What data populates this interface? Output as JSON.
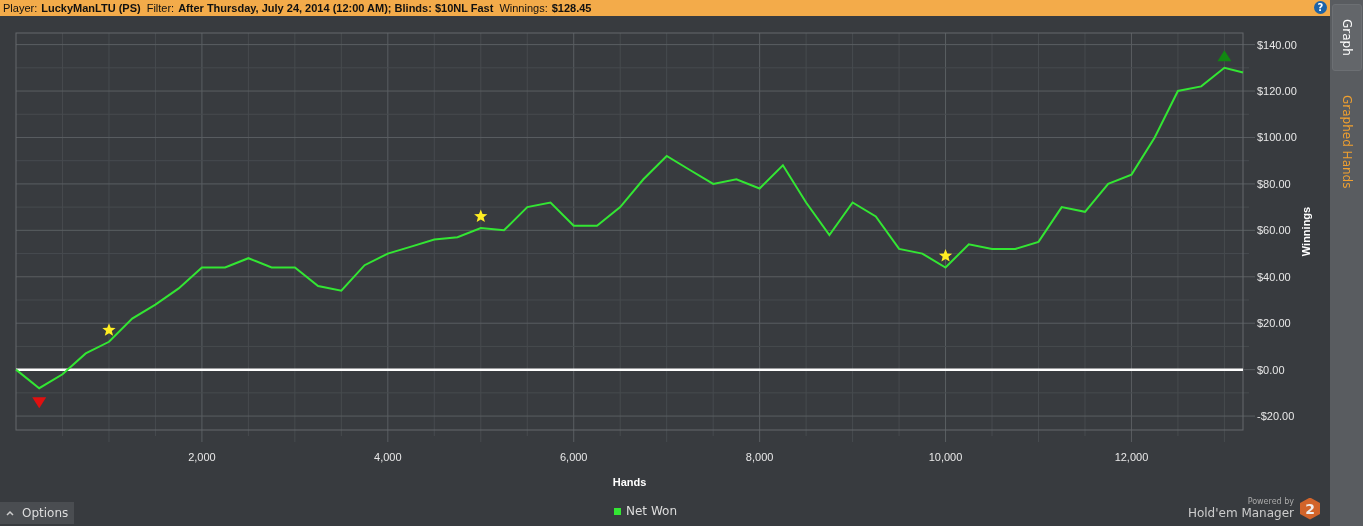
{
  "header": {
    "fields": [
      {
        "label": "Player:",
        "value": "LuckyManLTU (PS)"
      },
      {
        "label": "Filter:",
        "value": "After Thursday, July 24, 2014 (12:00 AM); Blinds: $10NL Fast"
      },
      {
        "label": "Winnings:",
        "value": "$128.45"
      }
    ],
    "help": "?"
  },
  "chart": {
    "chart_data": {
      "type": "line",
      "xlabel": "Hands",
      "ylabel": "Winnings",
      "xlim": [
        0,
        13200
      ],
      "ylim": [
        -26,
        145
      ],
      "xticks": [
        {
          "value": 2000,
          "label": "2,000"
        },
        {
          "value": 4000,
          "label": "4,000"
        },
        {
          "value": 6000,
          "label": "6,000"
        },
        {
          "value": 8000,
          "label": "8,000"
        },
        {
          "value": 10000,
          "label": "10,000"
        },
        {
          "value": 12000,
          "label": "12,000"
        }
      ],
      "yticks": [
        {
          "value": -20,
          "label": "-$20.00"
        },
        {
          "value": 0,
          "label": "$0.00"
        },
        {
          "value": 20,
          "label": "$20.00"
        },
        {
          "value": 40,
          "label": "$40.00"
        },
        {
          "value": 60,
          "label": "$60.00"
        },
        {
          "value": 80,
          "label": "$80.00"
        },
        {
          "value": 100,
          "label": "$100.00"
        },
        {
          "value": 120,
          "label": "$120.00"
        },
        {
          "value": 140,
          "label": "$140.00"
        }
      ],
      "x": [
        0,
        250,
        500,
        750,
        1000,
        1250,
        1500,
        1750,
        2000,
        2250,
        2500,
        2750,
        3000,
        3250,
        3500,
        3750,
        4000,
        4250,
        4500,
        4750,
        5000,
        5250,
        5500,
        5750,
        6000,
        6250,
        6500,
        6750,
        7000,
        7250,
        7500,
        7750,
        8000,
        8250,
        8500,
        8750,
        9000,
        9250,
        9500,
        9750,
        10000,
        10250,
        10500,
        10750,
        11000,
        11250,
        11500,
        11750,
        12000,
        12250,
        12500,
        12750,
        13000,
        13200
      ],
      "series": [
        {
          "name": "Net Won",
          "color": "#33e633",
          "values": [
            0,
            -8,
            -2,
            7,
            12,
            22,
            28,
            35,
            44,
            44,
            48,
            44,
            44,
            36,
            34,
            45,
            50,
            53,
            56,
            57,
            61,
            60,
            70,
            72,
            62,
            62,
            70,
            82,
            92,
            86,
            80,
            82,
            78,
            88,
            72,
            58,
            72,
            66,
            52,
            50,
            44,
            54,
            52,
            52,
            55,
            70,
            68,
            80,
            84,
            100,
            120,
            122,
            130,
            128
          ]
        }
      ],
      "grid": true
    }
  },
  "footer": {
    "options": "Options",
    "powered_by": "Powered by",
    "product": "Hold'em Manager",
    "badge": "2"
  },
  "sidebar": {
    "tabs": [
      {
        "label": "Graph",
        "selected": true
      },
      {
        "label": "Graphed Hands",
        "selected": false
      }
    ]
  }
}
